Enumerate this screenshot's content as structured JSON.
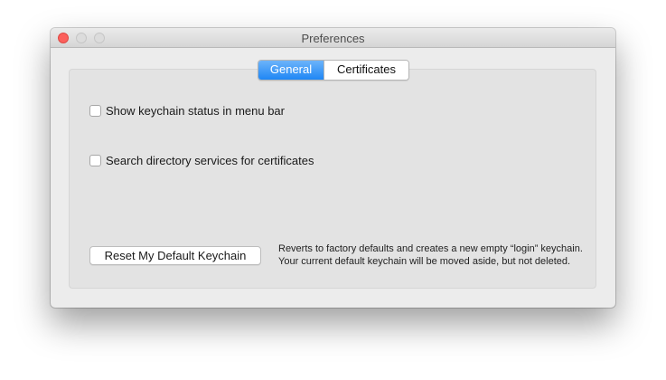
{
  "window": {
    "title": "Preferences"
  },
  "tabs": [
    {
      "label": "General",
      "selected": true
    },
    {
      "label": "Certificates",
      "selected": false
    }
  ],
  "options": [
    {
      "label": "Show keychain status in menu bar",
      "checked": false
    },
    {
      "label": "Search directory services for certificates",
      "checked": false
    }
  ],
  "reset": {
    "button_label": "Reset My Default Keychain",
    "description_line1": "Reverts to factory defaults and creates a new empty “login” keychain.",
    "description_line2": "Your current default keychain will be moved aside, but not deleted."
  },
  "colors": {
    "close_button": "#fc605c",
    "selected_tab": "#1f87f5"
  }
}
